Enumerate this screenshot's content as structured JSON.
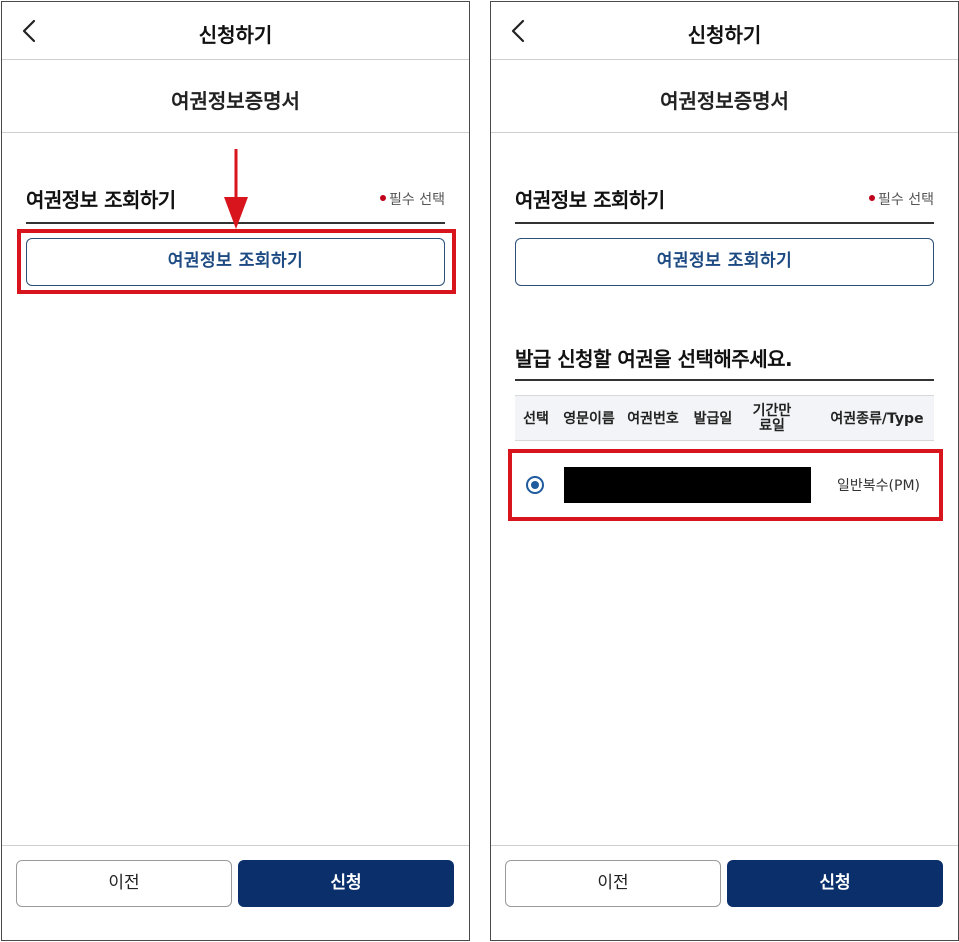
{
  "screens": [
    {
      "header": {
        "title": "신청하기",
        "back_icon": "chevron-left-icon"
      },
      "document_title": "여권정보증명서",
      "section": {
        "title": "여권정보 조회하기",
        "required_label": "필수 선택"
      },
      "lookup_button_label": "여권정보 조회하기",
      "footer": {
        "prev_label": "이전",
        "submit_label": "신청"
      }
    },
    {
      "header": {
        "title": "신청하기",
        "back_icon": "chevron-left-icon"
      },
      "document_title": "여권정보증명서",
      "section": {
        "title": "여권정보 조회하기",
        "required_label": "필수 선택"
      },
      "lookup_button_label": "여권정보 조회하기",
      "select_prompt": "발급 신청할 여권을 선택해주세요.",
      "table": {
        "columns": [
          "선택",
          "영문이름",
          "여권번호",
          "발급일",
          "기간만료일",
          "여권종류/Type"
        ],
        "rows": [
          {
            "selected": true,
            "english_name": "",
            "passport_no": "",
            "issue_date": "",
            "expiry_date": "",
            "passport_type": "일반복수(PM)"
          }
        ]
      },
      "footer": {
        "prev_label": "이전",
        "submit_label": "신청"
      }
    }
  ],
  "colors": {
    "highlight": "#d8141c",
    "accent": "#0a2f6b",
    "link_blue": "#1d4a82",
    "required_dot": "#c0001a"
  }
}
